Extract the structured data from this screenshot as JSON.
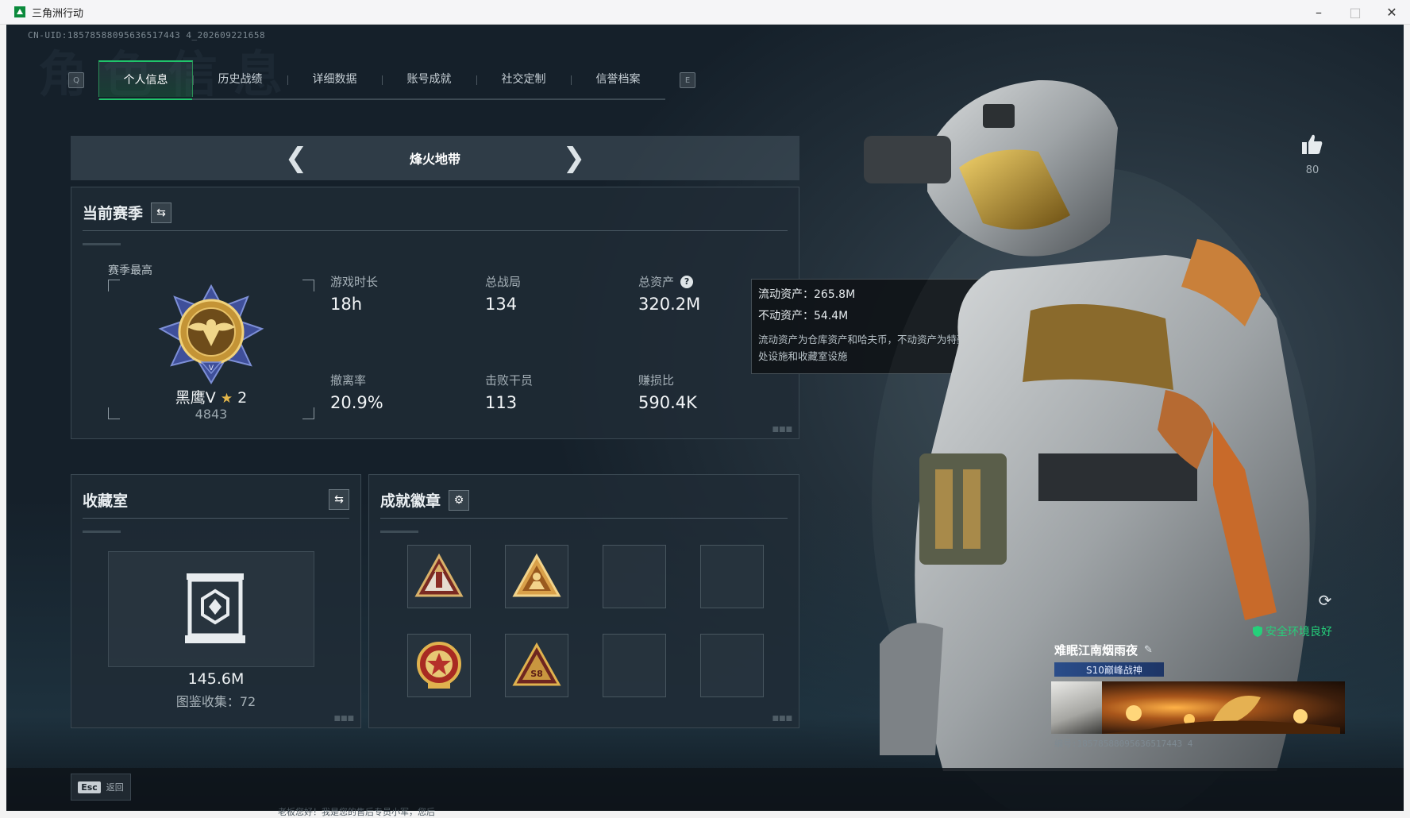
{
  "window": {
    "title": "三角洲行动"
  },
  "uid_line": "CN-UID:18578588095636517443 4_202609221658",
  "background_title": "角色信息",
  "tabs": {
    "left_key": "Q",
    "right_key": "E",
    "items": [
      "个人信息",
      "历史战绩",
      "详细数据",
      "账号成就",
      "社交定制",
      "信誉档案"
    ],
    "active": "个人信息"
  },
  "mode": {
    "name": "烽火地带"
  },
  "season": {
    "title": "当前赛季",
    "best_label": "赛季最高",
    "rank_name": "黑鹰V",
    "rank_star_count": "2",
    "rank_score": "4843",
    "stats": [
      {
        "label": "游戏时长",
        "value": "18h"
      },
      {
        "label": "总战局",
        "value": "134"
      },
      {
        "label": "总资产",
        "value": "320.2M"
      },
      {
        "label": "撤离率",
        "value": "20.9%"
      },
      {
        "label": "击败干员",
        "value": "113"
      },
      {
        "label": "赚损比",
        "value": "590.4K"
      }
    ]
  },
  "tooltip": {
    "liquid_assets": "流动资产：265.8M",
    "fixed_assets": "不动资产：54.4M",
    "description": "流动资产为仓库资产和哈夫币，不动资产为特勤处设施和收藏室设施"
  },
  "collection": {
    "title": "收藏室",
    "value": "145.6M",
    "count_text": "图鉴收集：72"
  },
  "badges": {
    "title": "成就徽章",
    "slots": [
      {
        "icon": "triangle-tower-badge-icon",
        "filled": true
      },
      {
        "icon": "triangle-soldier-badge-icon",
        "filled": true
      },
      {
        "icon": "",
        "filled": false
      },
      {
        "icon": "",
        "filled": false
      },
      {
        "icon": "star-medal-badge-icon",
        "filled": true
      },
      {
        "icon": "triangle-s8-badge-icon",
        "filled": true
      },
      {
        "icon": "",
        "filled": false
      },
      {
        "icon": "",
        "filled": false
      }
    ]
  },
  "likes": {
    "count": "80"
  },
  "environment_status": "安全环境良好",
  "player_card": {
    "name": "难眠江南烟雨夜",
    "title_badge": "S10巅峰战神",
    "id_line": "编号:18578588095636517443 4"
  },
  "bottom": {
    "esc_key": "Esc",
    "esc_label": "返回",
    "chat": "老板您好！我是您的售后专员小军，您后"
  },
  "colors": {
    "accent": "#20c46b",
    "gold": "#e3b64a",
    "panel": "#202c36"
  }
}
